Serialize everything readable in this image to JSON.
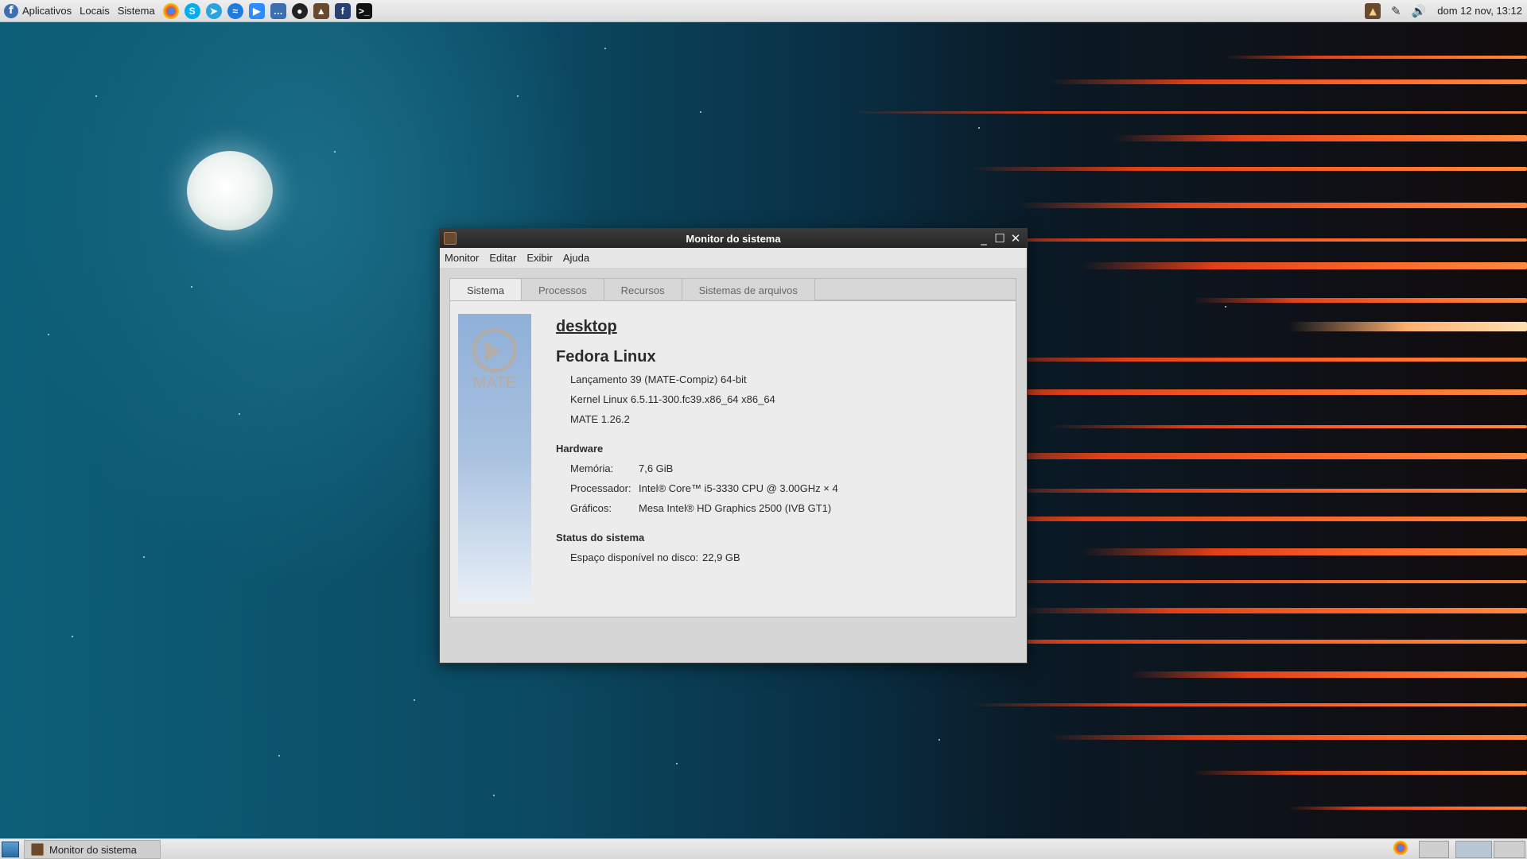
{
  "top_panel": {
    "menus": [
      "Aplicativos",
      "Locais",
      "Sistema"
    ],
    "launchers": [
      "chrome-icon",
      "skype-icon",
      "telegram-icon",
      "messenger-icon",
      "zoom-icon",
      "chat-icon",
      "obs-icon",
      "vlc-icon",
      "fedora-help-icon",
      "terminal-icon"
    ],
    "clock": "dom 12 nov, 13:12"
  },
  "window": {
    "title": "Monitor do sistema",
    "menu": [
      "Monitor",
      "Editar",
      "Exibir",
      "Ajuda"
    ],
    "tabs": [
      "Sistema",
      "Processos",
      "Recursos",
      "Sistemas de arquivos"
    ],
    "active_tab": "Sistema",
    "logo_text": "MATE",
    "hostname": "desktop",
    "distro": "Fedora Linux",
    "release": "Lançamento 39 (MATE-Compiz) 64-bit",
    "kernel": "Kernel Linux 6.5.11-300.fc39.x86_64 x86_64",
    "mate_version": "MATE 1.26.2",
    "hardware": {
      "title": "Hardware",
      "memory_label": "Memória:",
      "memory_value": "7,6 GiB",
      "cpu_label": "Processador:",
      "cpu_value": "Intel® Core™ i5-3330 CPU @ 3.00GHz × 4",
      "gpu_label": "Gráficos:",
      "gpu_value": "Mesa Intel® HD Graphics 2500 (IVB GT1)"
    },
    "status": {
      "title": "Status do sistema",
      "disk_label": "Espaço disponível no disco:",
      "disk_value": "22,9 GB"
    }
  },
  "taskbar": {
    "window_button": "Monitor do sistema"
  },
  "colors": {
    "titlebar": "#2e2e2e",
    "panel": "#e3e3e3",
    "accent": "#3c6eb4"
  }
}
